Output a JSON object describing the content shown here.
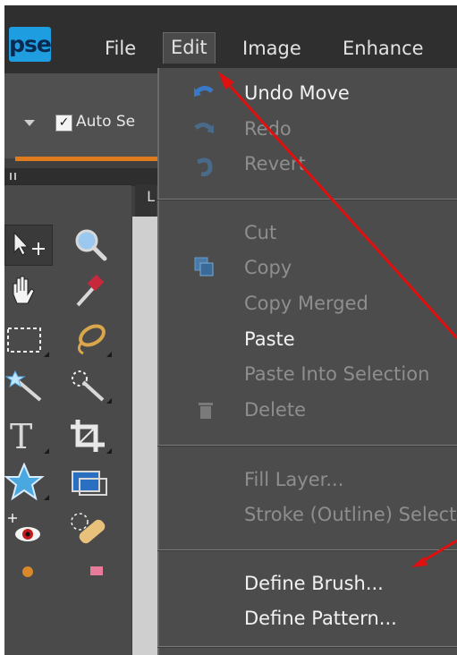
{
  "menubar": {
    "logo": "pse",
    "items": [
      {
        "label": "File"
      },
      {
        "label": "Edit"
      },
      {
        "label": "Image"
      },
      {
        "label": "Enhance"
      }
    ]
  },
  "options_bar": {
    "auto_select_label": "Auto Se",
    "auto_select_checked": true
  },
  "panel_tab": "L",
  "edit_menu": {
    "undo": "Undo Move",
    "redo": "Redo",
    "revert": "Revert",
    "cut": "Cut",
    "copy": "Copy",
    "copy_merged": "Copy Merged",
    "paste": "Paste",
    "paste_into": "Paste Into Selection",
    "delete": "Delete",
    "fill_layer": "Fill Layer...",
    "stroke": "Stroke (Outline) Select",
    "define_brush": "Define Brush...",
    "define_pattern": "Define Pattern..."
  },
  "annotation_color": "#e01010",
  "accent_color": "#e07a1f",
  "logo_color": "#1e9de0"
}
